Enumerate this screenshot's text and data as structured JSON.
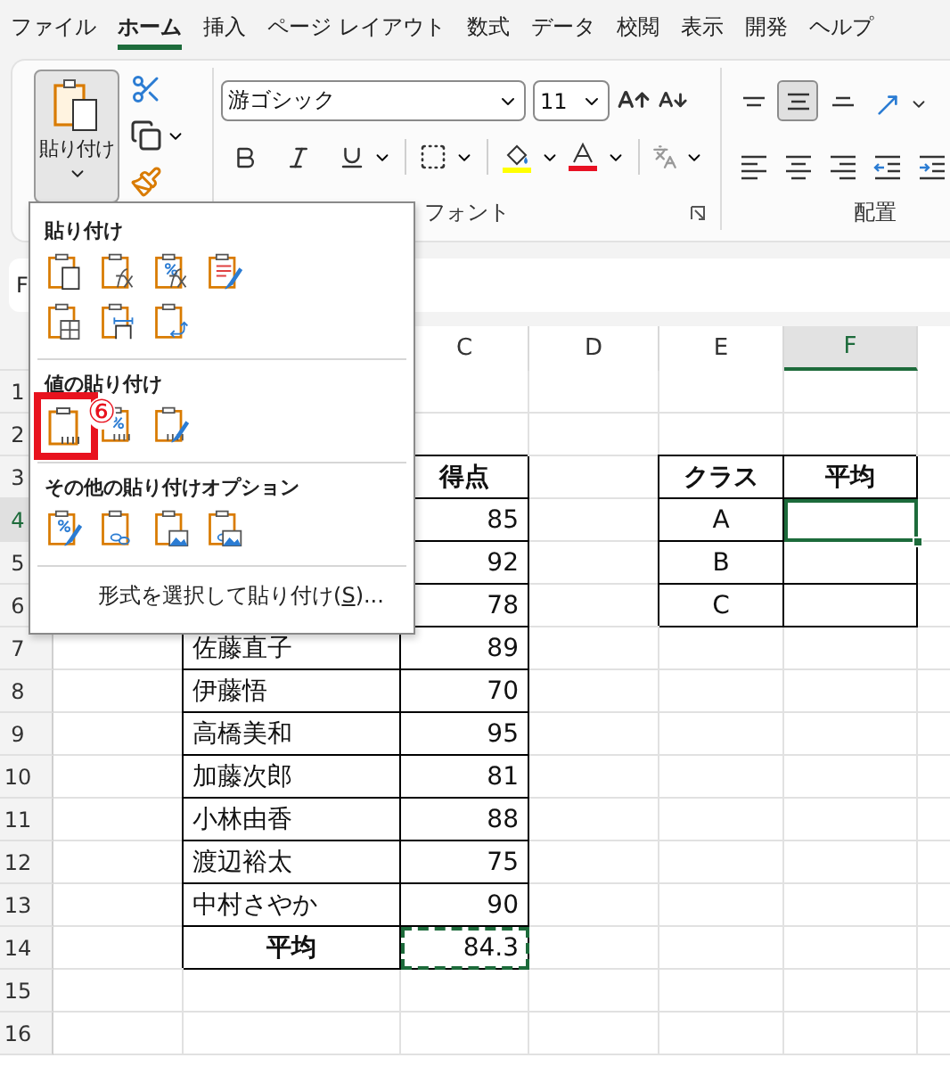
{
  "menu_tabs": [
    {
      "label": "ファイル",
      "selected": false
    },
    {
      "label": "ホーム",
      "selected": true
    },
    {
      "label": "挿入",
      "selected": false
    },
    {
      "label": "ページ レイアウト",
      "selected": false
    },
    {
      "label": "数式",
      "selected": false
    },
    {
      "label": "データ",
      "selected": false
    },
    {
      "label": "校閲",
      "selected": false
    },
    {
      "label": "表示",
      "selected": false
    },
    {
      "label": "開発",
      "selected": false
    },
    {
      "label": "ヘルプ",
      "selected": false
    }
  ],
  "ribbon": {
    "paste_label": "貼り付け",
    "font_name": "游ゴシック",
    "font_size": "11",
    "font_group_label": "フォント",
    "alignment_group_label": "配置",
    "alignment_buttons": [
      {
        "kind": "top",
        "pressed": false
      },
      {
        "kind": "middle",
        "pressed": true
      },
      {
        "kind": "bottom",
        "pressed": false
      },
      {
        "kind": "orientation",
        "pressed": false
      },
      {
        "kind": "left",
        "pressed": false
      },
      {
        "kind": "center",
        "pressed": false
      },
      {
        "kind": "right",
        "pressed": false
      },
      {
        "kind": "outdent",
        "pressed": false
      },
      {
        "kind": "indent",
        "pressed": false
      }
    ]
  },
  "name_box": {
    "value": "F"
  },
  "paste_menu": {
    "annotation": "⑥",
    "sections": [
      {
        "title": "貼り付け",
        "icons": [
          {
            "kind": "paste",
            "highlighted": false
          },
          {
            "kind": "formulas",
            "highlighted": false
          },
          {
            "kind": "formulas_number_format",
            "highlighted": false
          },
          {
            "kind": "keep_source_format",
            "highlighted": false
          },
          {
            "kind": "no_borders",
            "highlighted": false
          },
          {
            "kind": "keep_column_widths",
            "highlighted": false
          },
          {
            "kind": "transpose",
            "highlighted": false
          }
        ]
      },
      {
        "title": "値の貼り付け",
        "icons": [
          {
            "kind": "values",
            "highlighted": true
          },
          {
            "kind": "values_number_format",
            "highlighted": false
          },
          {
            "kind": "values_source_format",
            "highlighted": false
          }
        ]
      },
      {
        "title": "その他の貼り付けオプション",
        "icons": [
          {
            "kind": "formatting",
            "highlighted": false
          },
          {
            "kind": "link",
            "highlighted": false
          },
          {
            "kind": "picture",
            "highlighted": false
          },
          {
            "kind": "linked_picture",
            "highlighted": false
          }
        ]
      }
    ],
    "footer": {
      "label": "形式を選択して貼り付け(",
      "access_key": "S",
      "label_end": ")..."
    }
  },
  "sheet": {
    "columns": [
      {
        "label": "C",
        "selected": false
      },
      {
        "label": "D",
        "selected": false
      },
      {
        "label": "E",
        "selected": false
      },
      {
        "label": "F",
        "selected": true
      }
    ],
    "rows": [
      {
        "number": "1",
        "selected": false
      },
      {
        "number": "2",
        "selected": false
      },
      {
        "number": "3",
        "selected": false,
        "cells": [
          null,
          null,
          {
            "text": "得点",
            "kind": "header",
            "selected": false,
            "copied": false
          },
          null,
          {
            "text": "クラス",
            "kind": "header",
            "selected": false,
            "copied": false
          },
          {
            "text": "平均",
            "kind": "header",
            "selected": false,
            "copied": false
          }
        ]
      },
      {
        "number": "4",
        "selected": true,
        "cells": [
          null,
          null,
          {
            "text": "85",
            "kind": "number",
            "selected": false,
            "copied": false
          },
          null,
          {
            "text": "A",
            "kind": "center",
            "selected": false,
            "copied": false
          },
          {
            "kind": "empty",
            "selected": true,
            "copied": false
          }
        ]
      },
      {
        "number": "5",
        "selected": false,
        "cells": [
          null,
          null,
          {
            "text": "92",
            "kind": "number",
            "selected": false,
            "copied": false
          },
          null,
          {
            "text": "B",
            "kind": "center",
            "selected": false,
            "copied": false
          },
          {
            "kind": "empty",
            "selected": false,
            "copied": false
          }
        ]
      },
      {
        "number": "6",
        "selected": false,
        "cells": [
          null,
          null,
          {
            "text": "78",
            "kind": "number",
            "selected": false,
            "copied": false
          },
          null,
          {
            "text": "C",
            "kind": "center",
            "selected": false,
            "copied": false
          },
          {
            "kind": "empty",
            "selected": false,
            "copied": false
          }
        ]
      },
      {
        "number": "7",
        "selected": false,
        "cells": [
          null,
          {
            "text": "佐藤直子",
            "kind": "text",
            "selected": false,
            "copied": false
          },
          {
            "text": "89",
            "kind": "number",
            "selected": false,
            "copied": false
          }
        ]
      },
      {
        "number": "8",
        "selected": false,
        "cells": [
          null,
          {
            "text": "伊藤悟",
            "kind": "text",
            "selected": false,
            "copied": false
          },
          {
            "text": "70",
            "kind": "number",
            "selected": false,
            "copied": false
          }
        ]
      },
      {
        "number": "9",
        "selected": false,
        "cells": [
          null,
          {
            "text": "高橋美和",
            "kind": "text",
            "selected": false,
            "copied": false
          },
          {
            "text": "95",
            "kind": "number",
            "selected": false,
            "copied": false
          }
        ]
      },
      {
        "number": "10",
        "selected": false,
        "cells": [
          null,
          {
            "text": "加藤次郎",
            "kind": "text",
            "selected": false,
            "copied": false
          },
          {
            "text": "81",
            "kind": "number",
            "selected": false,
            "copied": false
          }
        ]
      },
      {
        "number": "11",
        "selected": false,
        "cells": [
          null,
          {
            "text": "小林由香",
            "kind": "text",
            "selected": false,
            "copied": false
          },
          {
            "text": "88",
            "kind": "number",
            "selected": false,
            "copied": false
          }
        ]
      },
      {
        "number": "12",
        "selected": false,
        "cells": [
          null,
          {
            "text": "渡辺裕太",
            "kind": "text",
            "selected": false,
            "copied": false
          },
          {
            "text": "75",
            "kind": "number",
            "selected": false,
            "copied": false
          }
        ]
      },
      {
        "number": "13",
        "selected": false,
        "cells": [
          null,
          {
            "text": "中村さやか",
            "kind": "text",
            "selected": false,
            "copied": false
          },
          {
            "text": "90",
            "kind": "number",
            "selected": false,
            "copied": false
          }
        ]
      },
      {
        "number": "14",
        "selected": false,
        "cells": [
          null,
          {
            "text": "平均",
            "kind": "header",
            "selected": false,
            "copied": false
          },
          {
            "text": "84.3",
            "kind": "number",
            "selected": false,
            "copied": true
          }
        ]
      },
      {
        "number": "15",
        "selected": false
      },
      {
        "number": "16",
        "selected": false
      }
    ]
  }
}
